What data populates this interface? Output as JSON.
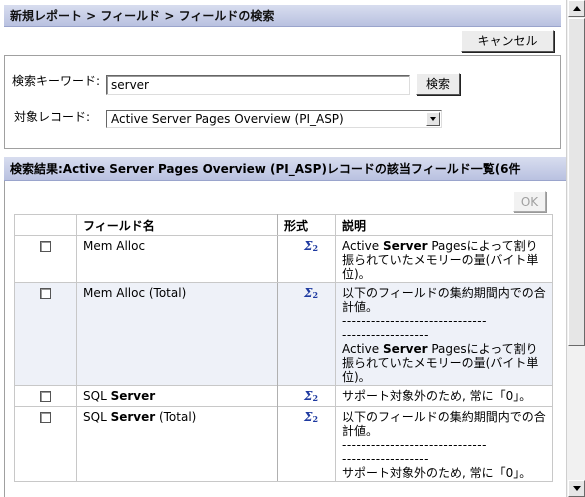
{
  "breadcrumb": "新規レポート > フィールド > フィールドの検索",
  "cancel_label": "キャンセル",
  "search": {
    "keyword_label": "検索キーワード:",
    "keyword_value": "server",
    "search_button": "検索",
    "record_label": "対象レコード:",
    "record_value": "Active Server Pages Overview (PI_ASP)"
  },
  "results": {
    "header": "検索結果:Active Server Pages Overview (PI_ASP)レコードの該当フィールド一覧(6件",
    "ok_label": "OK",
    "columns": {
      "field": "フィールド名",
      "format": "形式",
      "desc": "説明"
    },
    "rows": [
      {
        "name": "Mem Alloc",
        "format_icon": "sigma-format-icon",
        "desc": {
          "pre": "Active ",
          "kw": "Server",
          "post": " Pagesによって割り振られていたメモリーの量(バイト単位)。"
        }
      },
      {
        "name": "Mem Alloc (Total)",
        "format_icon": "sigma-format-icon",
        "desc": {
          "intro": "以下のフィールドの集約期間内での合計値。",
          "dash1": "------------------------------",
          "dash2": "------------------",
          "pre": "Active ",
          "kw": "Server",
          "post": " Pagesによって割り振られていたメモリーの量(バイト単位)。"
        }
      },
      {
        "name_pre": "SQL ",
        "name_kw": "Server",
        "format_icon": "sigma-format-icon",
        "desc": {
          "text": "サポート対象外のため, 常に「0」。"
        }
      },
      {
        "name_pre": "SQL ",
        "name_kw": "Server",
        "name_post": " (Total)",
        "format_icon": "sigma-format-icon",
        "desc": {
          "intro": "以下のフィールドの集約期間内での合計値。",
          "dash1": "------------------------------",
          "dash2": "------------------",
          "text": "サポート対象外のため, 常に「0」。"
        }
      }
    ]
  }
}
